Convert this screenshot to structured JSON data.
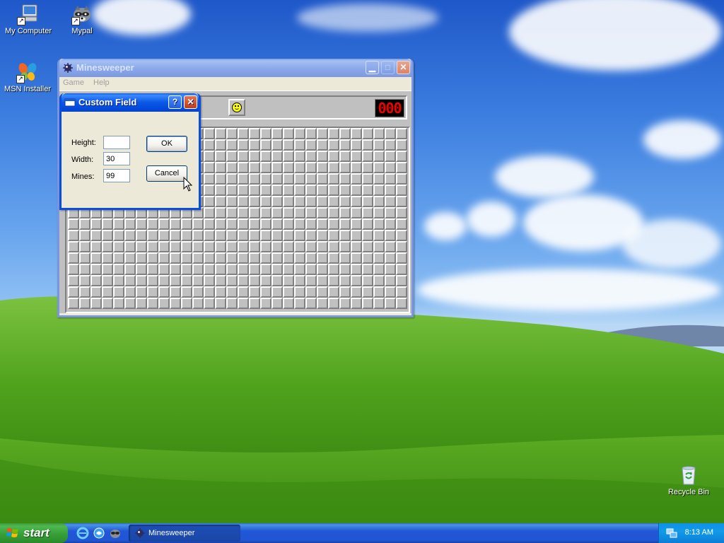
{
  "desktop": {
    "icons": [
      {
        "label": "My Computer",
        "icon": "my-computer-icon"
      },
      {
        "label": "Mypal",
        "icon": "mypal-raccoon-icon"
      },
      {
        "label": "MSN Installer",
        "icon": "msn-butterfly-icon"
      },
      {
        "label": "Recycle Bin",
        "icon": "recycle-bin-icon"
      }
    ]
  },
  "minesweeper": {
    "title": "Minesweeper",
    "menu": [
      "Game",
      "Help"
    ],
    "mine_counter": "",
    "timer": "000",
    "rows": 16,
    "cols": 30
  },
  "dialog": {
    "title": "Custom Field",
    "height_label": "Height:",
    "height_value": "",
    "width_label": "Width:",
    "width_value": "30",
    "mines_label": "Mines:",
    "mines_value": "99",
    "ok_label": "OK",
    "cancel_label": "Cancel"
  },
  "taskbar": {
    "start_label": "start",
    "task_label": "Minesweeper",
    "clock": "8:13 AM"
  },
  "colors": {
    "xp_blue": "#0a4ee0",
    "counter_red": "#e00000",
    "start_green": "#38a038"
  }
}
